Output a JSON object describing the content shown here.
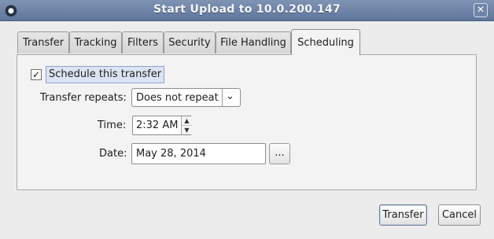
{
  "window": {
    "title": "Start Upload to 10.0.200.147",
    "close_glyph": "✕",
    "app_icon": "app-logo-icon"
  },
  "tabs": [
    {
      "label": "Transfer",
      "active": false
    },
    {
      "label": "Tracking",
      "active": false
    },
    {
      "label": "Filters",
      "active": false
    },
    {
      "label": "Security",
      "active": false
    },
    {
      "label": "File Handling",
      "active": false
    },
    {
      "label": "Scheduling",
      "active": true
    }
  ],
  "scheduling": {
    "schedule_checkbox": {
      "label": "Schedule this transfer",
      "checked": true,
      "glyph": "✓"
    },
    "repeats": {
      "label": "Transfer repeats:",
      "value": "Does not repeat",
      "arrow": "⌄"
    },
    "time": {
      "label": "Time:",
      "value": "2:32 AM",
      "up": "▲",
      "down": "▼"
    },
    "date": {
      "label": "Date:",
      "value": "May 28, 2014",
      "browse_label": "..."
    }
  },
  "buttons": {
    "transfer": "Transfer",
    "cancel": "Cancel"
  },
  "colors": {
    "titlebar": "#6f84a8",
    "selection": "#dbe4f4"
  }
}
